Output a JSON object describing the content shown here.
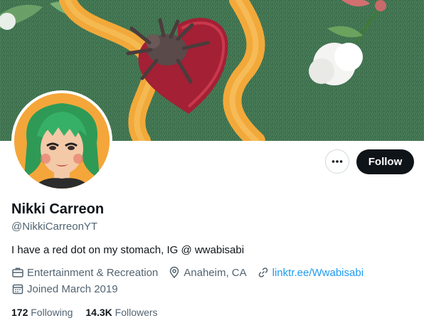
{
  "profile": {
    "display_name": "Nikki Carreon",
    "handle": "@NikkiCarreonYT",
    "bio": "I have a red dot on my stomach, IG @ wwabisabi",
    "category": "Entertainment & Recreation",
    "location": "Anaheim, CA",
    "website": "linktr.ee/Wwabisabi",
    "joined": "Joined March 2019"
  },
  "stats": {
    "following_count": "172",
    "following_label": "Following",
    "followers_count": "14.3K",
    "followers_label": "Followers"
  },
  "actions": {
    "follow_label": "Follow",
    "more_icon": "more-horizontal-icon"
  },
  "icons": {
    "category": "briefcase-icon",
    "location": "location-pin-icon",
    "website": "link-icon",
    "joined": "calendar-icon"
  },
  "colors": {
    "accent_link": "#1d9bf0",
    "text_primary": "#0f1419",
    "text_secondary": "#536471",
    "follow_button_bg": "#0f1419"
  }
}
